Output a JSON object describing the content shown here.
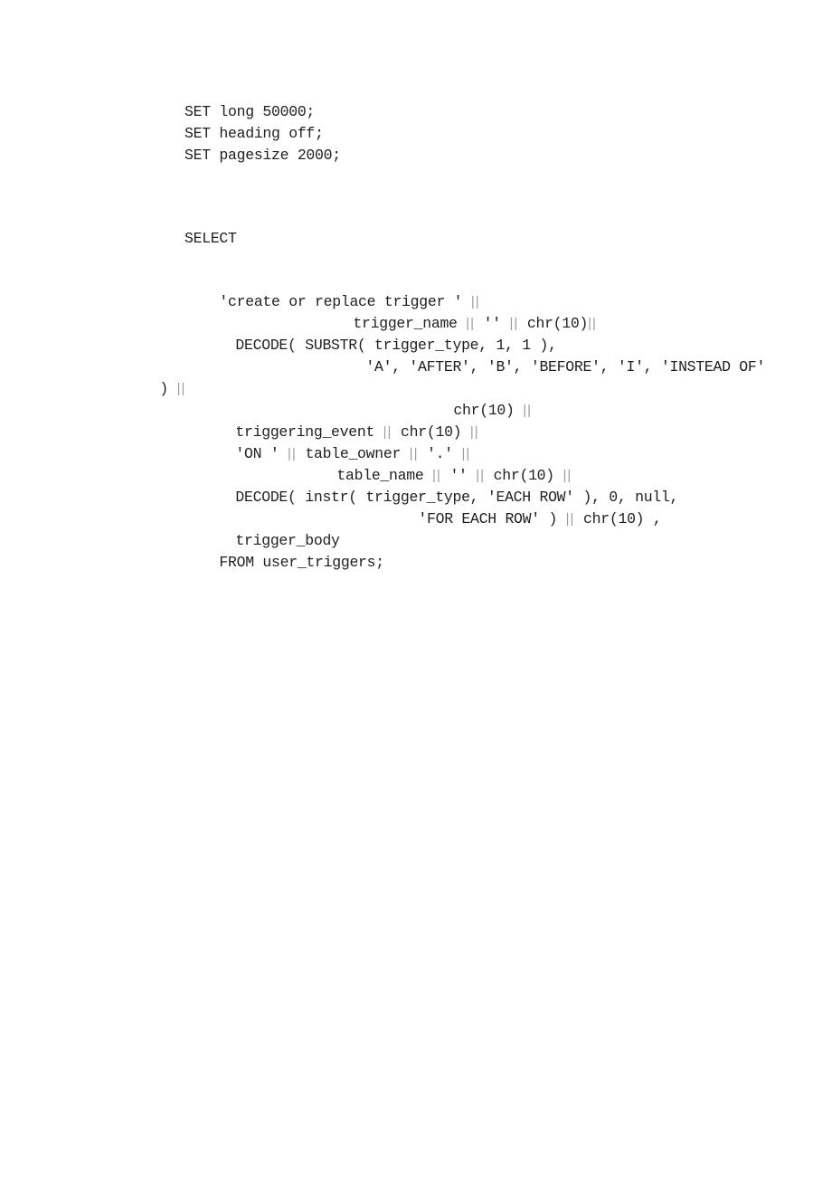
{
  "document": {
    "setup_lines": [
      "SET long 50000;",
      "SET heading off;",
      "SET pagesize 2000;"
    ],
    "query": {
      "select_keyword": "SELECT",
      "lines": [
        {
          "segments": [
            "'create or replace trigger ' ",
            "||"
          ]
        },
        {
          "segments": [
            "trigger_name ",
            "||",
            " '' ",
            "||",
            " chr(10)",
            "||"
          ]
        },
        {
          "segments": [
            "DECODE( SUBSTR( trigger_type, 1, 1 ),"
          ]
        },
        {
          "segments": [
            "'A', 'AFTER', 'B', 'BEFORE', 'I', 'INSTEAD OF'"
          ]
        },
        {
          "segments": [
            ") ",
            "||"
          ]
        },
        {
          "segments": [
            "chr(10) ",
            "||"
          ]
        },
        {
          "segments": [
            "triggering_event ",
            "||",
            " chr(10) ",
            "||"
          ]
        },
        {
          "segments": [
            "'ON ' ",
            "||",
            " table_owner ",
            "||",
            " '.' ",
            "||"
          ]
        },
        {
          "segments": [
            "table_name ",
            "||",
            " '' ",
            "||",
            " chr(10) ",
            "||"
          ]
        },
        {
          "segments": [
            "DECODE( instr( trigger_type, 'EACH ROW' ), 0, null,"
          ]
        },
        {
          "segments": [
            "'FOR EACH ROW' ) ",
            "||",
            " chr(10) ,"
          ]
        },
        {
          "segments": [
            "trigger_body"
          ]
        },
        {
          "segments": [
            "FROM user_triggers;"
          ]
        }
      ]
    }
  }
}
